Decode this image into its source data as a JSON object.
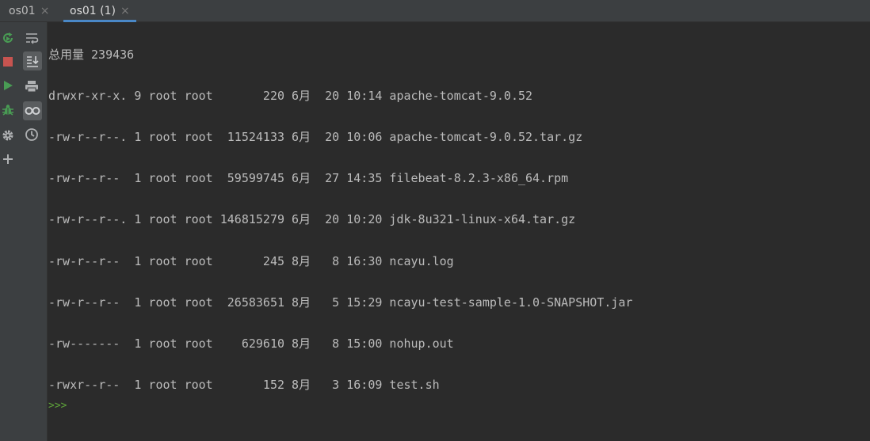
{
  "tabs": [
    {
      "label": "os01",
      "close": "×"
    },
    {
      "label": "os01 (1)",
      "close": "×"
    }
  ],
  "sidebar_left": [
    {
      "icon": "rerun-icon",
      "color": "#499c54"
    },
    {
      "icon": "stop-icon",
      "color": "#c75450"
    },
    {
      "icon": "run-icon",
      "color": "#499c54"
    },
    {
      "icon": "debug-icon",
      "color": "#499c54"
    },
    {
      "icon": "settings-icon",
      "color": "#afb1b3"
    },
    {
      "icon": "add-icon",
      "color": "#afb1b3"
    }
  ],
  "sidebar_tools": [
    {
      "icon": "soft-wrap-icon"
    },
    {
      "icon": "scroll-to-end-icon"
    },
    {
      "icon": "print-icon"
    },
    {
      "icon": "view-icon"
    },
    {
      "icon": "history-icon"
    }
  ],
  "console": {
    "total": "总用量 239436",
    "lines": [
      "drwxr-xr-x. 9 root root       220 6月  20 10:14 apache-tomcat-9.0.52",
      "-rw-r--r--. 1 root root  11524133 6月  20 10:06 apache-tomcat-9.0.52.tar.gz",
      "-rw-r--r--  1 root root  59599745 6月  27 14:35 filebeat-8.2.3-x86_64.rpm",
      "-rw-r--r--. 1 root root 146815279 6月  20 10:20 jdk-8u321-linux-x64.tar.gz",
      "-rw-r--r--  1 root root       245 8月   8 16:30 ncayu.log",
      "-rw-r--r--  1 root root  26583651 8月   5 15:29 ncayu-test-sample-1.0-SNAPSHOT.jar",
      "-rw-------  1 root root    629610 8月   8 15:00 nohup.out",
      "-rwxr--r--  1 root root       152 8月   3 16:09 test.sh"
    ],
    "prompt": ">>>"
  },
  "colors": {
    "background": "#2b2b2b",
    "text": "#bbbbbb",
    "prompt": "#5ea33a",
    "accent": "#4a88c7"
  }
}
